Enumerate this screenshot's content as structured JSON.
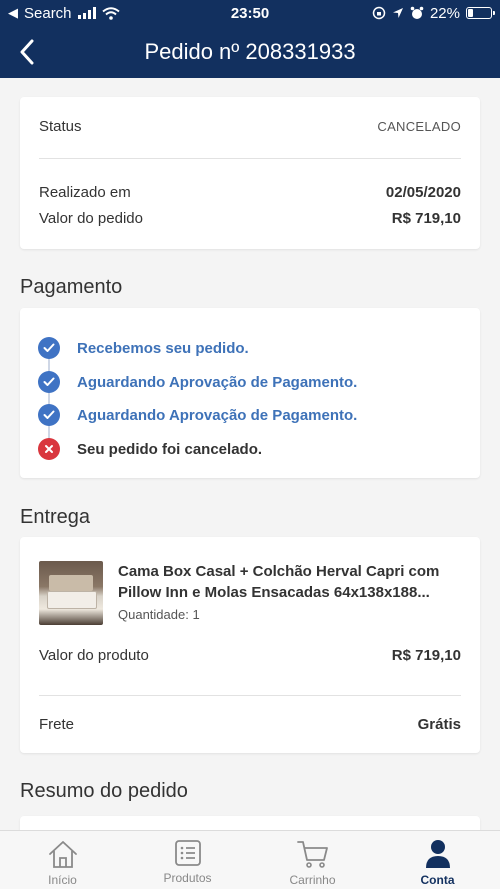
{
  "status_bar": {
    "carrier": "Search",
    "time": "23:50",
    "battery": "22%",
    "battery_level": 0.22
  },
  "header": {
    "title": "Pedido nº 208331933"
  },
  "summary_card": {
    "status_label": "Status",
    "status_value": "CANCELADO",
    "date_label": "Realizado em",
    "date_value": "02/05/2020",
    "total_label": "Valor do pedido",
    "total_value": "R$  719,10"
  },
  "payment": {
    "title": "Pagamento",
    "steps": [
      {
        "label": "Recebemos seu pedido.",
        "state": "done"
      },
      {
        "label": "Aguardando Aprovação de Pagamento.",
        "state": "done"
      },
      {
        "label": "Aguardando Aprovação de Pagamento.",
        "state": "done"
      },
      {
        "label": "Seu pedido foi cancelado.",
        "state": "cancelled"
      }
    ]
  },
  "delivery": {
    "title": "Entrega",
    "product_name": "Cama Box Casal + Colchão Herval Capri com Pillow Inn e Molas Ensacadas 64x138x188...",
    "quantity": "Quantidade: 1",
    "product_value_label": "Valor do produto",
    "product_value": "R$  719,10",
    "shipping_label": "Frete",
    "shipping_value": "Grátis"
  },
  "order_summary": {
    "title": "Resumo do pedido"
  },
  "tabbar": {
    "tabs": [
      {
        "label": "Início",
        "icon": "home-icon"
      },
      {
        "label": "Produtos",
        "icon": "list-icon"
      },
      {
        "label": "Carrinho",
        "icon": "cart-icon"
      },
      {
        "label": "Conta",
        "icon": "user-icon",
        "active": true
      }
    ]
  },
  "colors": {
    "header_bg": "#12305f",
    "step_done": "#3f73c4",
    "step_cancelled": "#d9363e"
  }
}
